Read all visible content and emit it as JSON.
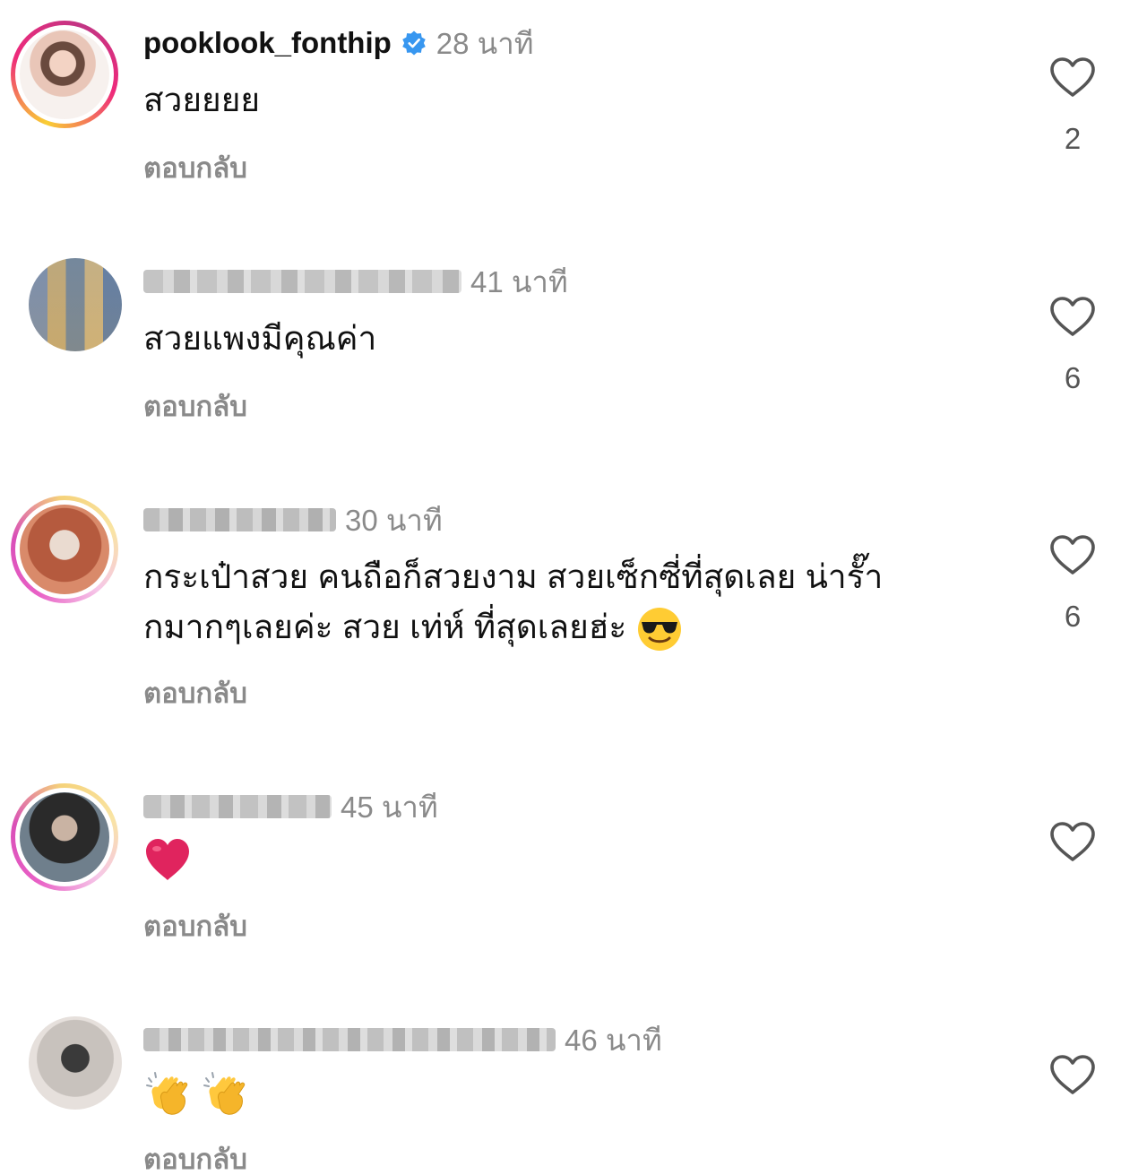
{
  "comments": [
    {
      "username": "pooklook_fonthip",
      "verified": true,
      "time": "28 นาที",
      "text": "สวยยยย",
      "reply": "ตอบกลับ",
      "likes": "2",
      "avatar": "profile-photo"
    },
    {
      "username": "",
      "time": "41 นาที",
      "text": "สวยแพงมีคุณค่า",
      "reply": "ตอบกลับ",
      "likes": "6",
      "avatar": "pixelated-avatar"
    },
    {
      "username": "",
      "time": "30 นาที",
      "text_line1": "กระเป๋าสวย คนถือก็สวยงาม สวยเซ็กซี่ที่สุดเลย น่ารั๊า",
      "text_line2": "กมากๆเลยค่ะ สวย เท่ห์ ที่สุดเลยฮ่ะ",
      "emoji": "smiling-face-with-sunglasses",
      "reply": "ตอบกลับ",
      "likes": "6",
      "avatar": "pixelated-avatar"
    },
    {
      "username": "",
      "time": "45 นาที",
      "emoji": "red-heart",
      "reply": "ตอบกลับ",
      "likes": "",
      "avatar": "pixelated-avatar"
    },
    {
      "username": "",
      "time": "46 นาที",
      "emoji": "clapping-hands",
      "reply": "ตอบกลับ",
      "likes": "",
      "avatar": "pixelated-avatar"
    }
  ],
  "icons": {
    "like": "heart-outline-icon",
    "verified": "verified-badge-icon"
  },
  "colors": {
    "verified": "#3897f0",
    "secondary_text": "#8a8a8a",
    "heart_emoji": "#e0245e"
  }
}
